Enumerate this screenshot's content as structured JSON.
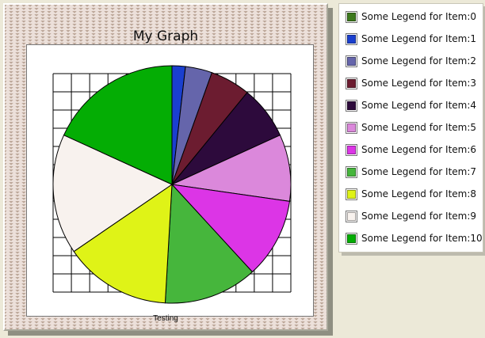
{
  "chart_data": {
    "type": "pie",
    "title": "My Graph",
    "xlabel": "Testing",
    "ylabel": "",
    "grid": true,
    "legend_placement": "right",
    "categories": [
      "Some Legend for Item:0",
      "Some Legend for Item:1",
      "Some Legend for Item:2",
      "Some Legend for Item:3",
      "Some Legend for Item:4",
      "Some Legend for Item:5",
      "Some Legend for Item:6",
      "Some Legend for Item:7",
      "Some Legend for Item:8",
      "Some Legend for Item:9",
      "Some Legend for Item:10"
    ],
    "values": [
      0,
      1,
      2,
      3,
      4,
      5,
      6,
      7,
      8,
      9,
      10
    ],
    "colors": [
      "#3d7a1d",
      "#1a3fcf",
      "#6565ab",
      "#6c1c30",
      "#2d0a3c",
      "#db88db",
      "#dc35e6",
      "#46b63c",
      "#dff317",
      "#f8f2ee",
      "#04ad04"
    ]
  }
}
